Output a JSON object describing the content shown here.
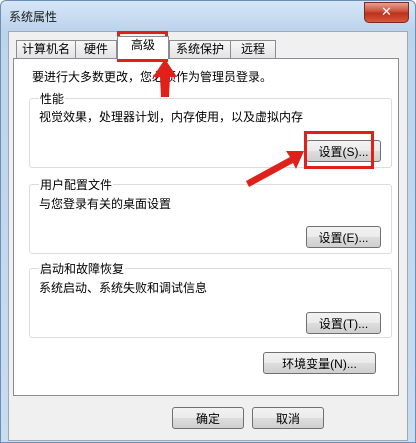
{
  "window": {
    "title": "系统属性",
    "close_symbol": "✕"
  },
  "tabs": [
    {
      "label": "计算机名"
    },
    {
      "label": "硬件"
    },
    {
      "label": "高级"
    },
    {
      "label": "系统保护"
    },
    {
      "label": "远程"
    }
  ],
  "active_tab": "高级",
  "admin_note": "要进行大多数更改，您必须作为管理员登录。",
  "performance": {
    "title": "性能",
    "description": "视觉效果，处理器计划，内存使用，以及虚拟内存",
    "settings_button": "设置(S)..."
  },
  "user_profiles": {
    "title": "用户配置文件",
    "description": "与您登录有关的桌面设置",
    "settings_button": "设置(E)..."
  },
  "startup_recovery": {
    "title": "启动和故障恢复",
    "description": "系统启动、系统失败和调试信息",
    "settings_button": "设置(T)..."
  },
  "env_button": "环境变量(N)...",
  "footer": {
    "ok": "确定",
    "cancel": "取消"
  },
  "annotation_color": "#e0201b"
}
